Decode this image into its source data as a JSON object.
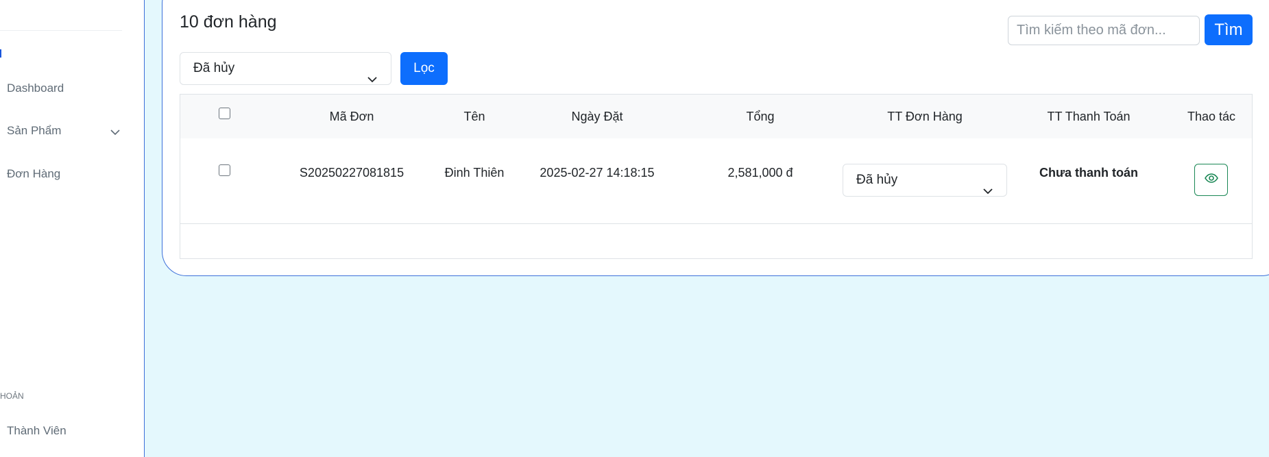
{
  "sidebar": {
    "items": [
      {
        "label": "Dashboard"
      },
      {
        "label": "Sản Phẩm"
      },
      {
        "label": "Đơn Hàng"
      },
      {
        "label": "Thành Viên"
      }
    ],
    "section_label": "HOẢN"
  },
  "main": {
    "title": "10 đơn hàng",
    "search": {
      "placeholder": "Tìm kiếm theo mã đơn...",
      "button_label": "Tìm"
    },
    "filter": {
      "selected": "Đã hủy",
      "button_label": "Lọc"
    }
  },
  "table": {
    "headers": [
      "Mã Đơn",
      "Tên",
      "Ngày Đặt",
      "Tổng",
      "TT Đơn Hàng",
      "TT Thanh Toán",
      "Thao tác"
    ],
    "rows": [
      {
        "code": "S20250227081815",
        "name": "Đinh Thiên",
        "date": "2025-02-27 14:18:15",
        "total": "2,581,000 đ",
        "order_status": "Đã hủy",
        "payment_status": "Chưa thanh toán",
        "action_icon": "eye-icon"
      }
    ]
  },
  "colors": {
    "primary": "#0d6efd",
    "page_background": "#e4f8fd",
    "panel_border": "#3b6fd9",
    "view_button": "#198754"
  }
}
